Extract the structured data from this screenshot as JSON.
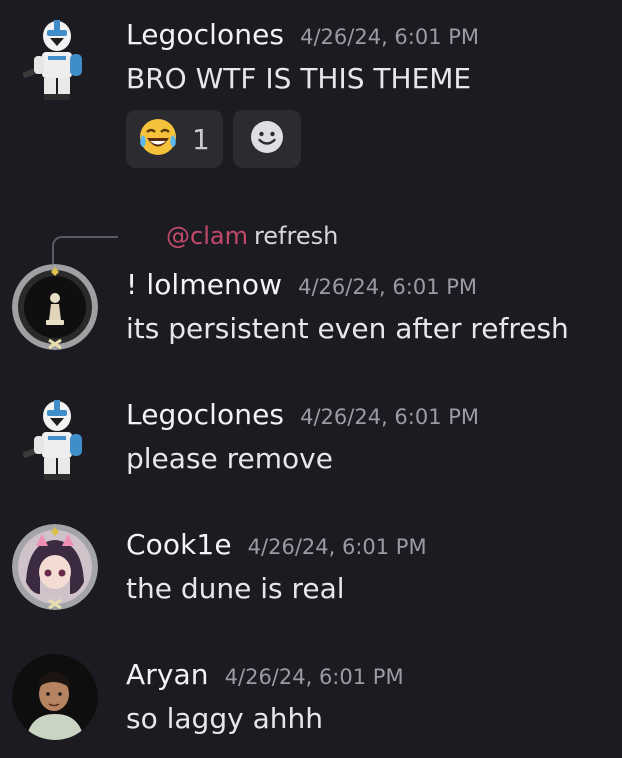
{
  "messages": [
    {
      "username": "Legoclones",
      "timestamp": "4/26/24, 6:01 PM",
      "content": "BRO WTF IS THIS THEME",
      "avatar": "clone-trooper-avatar",
      "reactions": [
        {
          "emoji": "😂",
          "count": "1"
        },
        {
          "emoji": "☻",
          "type": "add-reaction"
        }
      ]
    },
    {
      "reply_to": {
        "mention": "@clam",
        "text": "refresh"
      },
      "username": "! lolmenow",
      "timestamp": "4/26/24, 6:01 PM",
      "content": "its persistent even after refresh",
      "avatar": "chess-pawn-avatar"
    },
    {
      "username": "Legoclones",
      "timestamp": "4/26/24, 6:01 PM",
      "content": "please remove",
      "avatar": "clone-trooper-avatar"
    },
    {
      "username": "Cook1e",
      "timestamp": "4/26/24, 6:01 PM",
      "content": "the dune is real",
      "avatar": "anime-girl-avatar"
    },
    {
      "username": "Aryan",
      "timestamp": "4/26/24, 6:01 PM",
      "content": "so laggy ahhh",
      "avatar": "person-photo-avatar"
    }
  ],
  "colors": {
    "background": "#1c1b21",
    "mention": "#c24a6b",
    "timestamp": "#9a9ba3"
  }
}
